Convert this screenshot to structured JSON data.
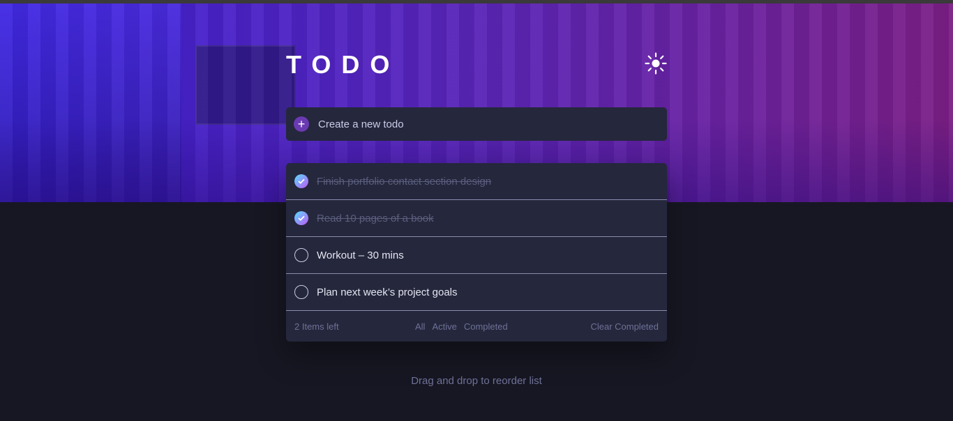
{
  "app": {
    "title": "TODO",
    "theme_icon": "sun-icon"
  },
  "new_todo": {
    "placeholder": "Create a new todo",
    "icon": "plus-icon"
  },
  "todos": [
    {
      "text": "Finish portfolio contact section design",
      "completed": true
    },
    {
      "text": "Read 10 pages of a book",
      "completed": true
    },
    {
      "text": "Workout – 30 mins",
      "completed": false
    },
    {
      "text": "Plan next week’s project goals",
      "completed": false
    }
  ],
  "footer": {
    "items_left": "2 Items left",
    "filters": {
      "all": "All",
      "active": "Active",
      "completed": "Completed"
    },
    "clear": "Clear Completed"
  },
  "hint": "Drag and drop to reorder list",
  "colors": {
    "background": "#171723",
    "panel": "#25273c",
    "check_gradient_start": "#57ddff",
    "check_gradient_end": "#c058f3",
    "accent": "#6a3ab2"
  }
}
